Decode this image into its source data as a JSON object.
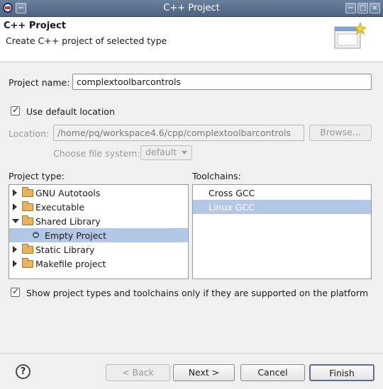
{
  "window": {
    "title": "C++ Project"
  },
  "header": {
    "title": "C++ Project",
    "description": "Create C++ project of selected type"
  },
  "project_name": {
    "label": "Project name:",
    "value": "complextoolbarcontrols"
  },
  "use_default_location": {
    "label": "Use default location",
    "checked": true
  },
  "location": {
    "label": "Location:",
    "value": "/home/pq/workspace4.6/cpp/complextoolbarcontrols",
    "browse_label": "Browse..."
  },
  "file_system": {
    "label": "Choose file system:",
    "value": "default"
  },
  "project_type": {
    "label": "Project type:",
    "items": [
      {
        "label": "GNU Autotools",
        "kind": "folder",
        "state": "collapsed"
      },
      {
        "label": "Executable",
        "kind": "folder",
        "state": "collapsed"
      },
      {
        "label": "Shared Library",
        "kind": "folder",
        "state": "expanded"
      },
      {
        "label": "Empty Project",
        "kind": "project",
        "selected": true
      },
      {
        "label": "Static Library",
        "kind": "folder",
        "state": "collapsed"
      },
      {
        "label": "Makefile project",
        "kind": "folder",
        "state": "collapsed"
      }
    ]
  },
  "toolchains": {
    "label": "Toolchains:",
    "items": [
      {
        "label": "Cross GCC",
        "selected": false
      },
      {
        "label": "Linux GCC",
        "selected": true
      }
    ]
  },
  "filter_option": {
    "label": "Show project types and toolchains only if they are supported on the platform",
    "checked": true
  },
  "buttons": {
    "help": "?",
    "back": "< Back",
    "next": "Next >",
    "cancel": "Cancel",
    "finish": "Finish"
  },
  "colors": {
    "selection": "#b3c8e6",
    "titlebar": "#5b6f8e"
  }
}
